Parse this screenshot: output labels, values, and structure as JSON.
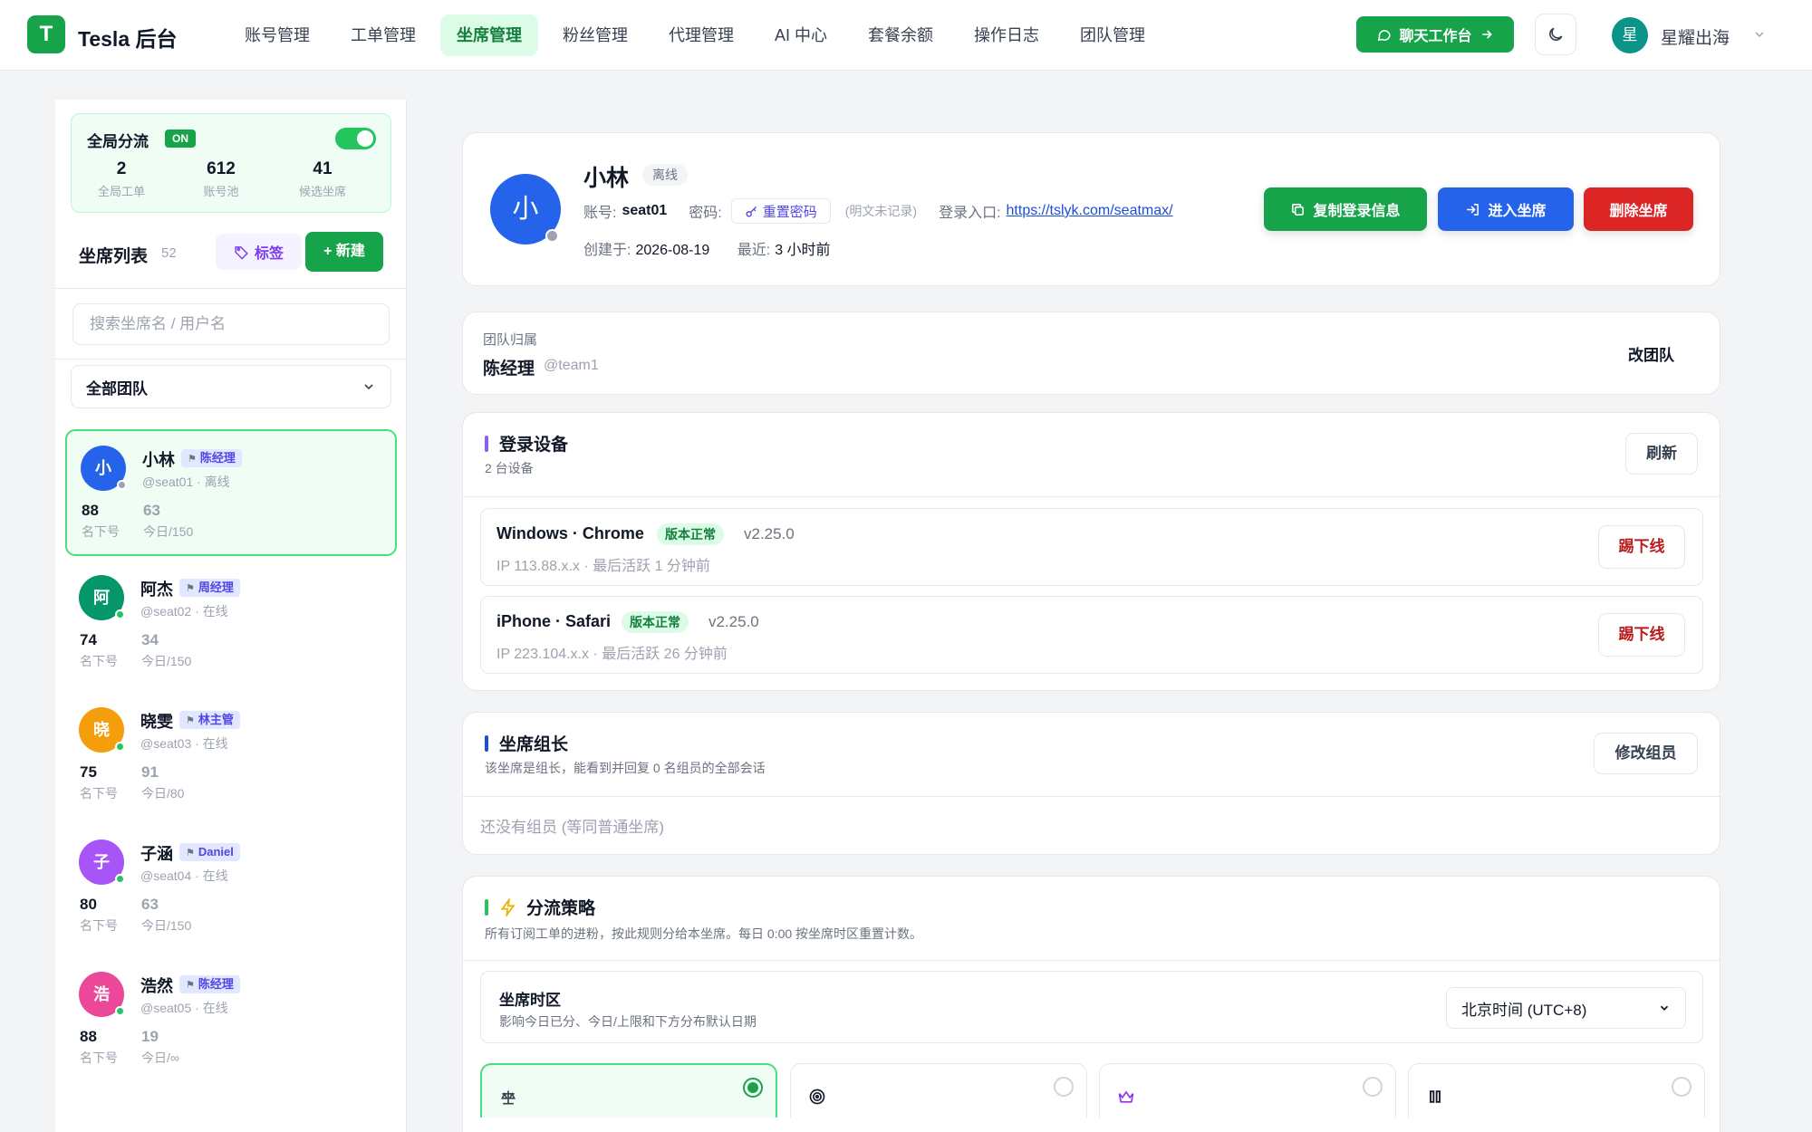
{
  "brand": {
    "name": "Tesla 后台",
    "logo_letter": "T"
  },
  "nav": [
    {
      "label": "账号管理"
    },
    {
      "label": "工单管理"
    },
    {
      "label": "坐席管理",
      "active": true
    },
    {
      "label": "粉丝管理"
    },
    {
      "label": "代理管理"
    },
    {
      "label": "AI 中心"
    },
    {
      "label": "套餐余额"
    },
    {
      "label": "操作日志"
    },
    {
      "label": "团队管理"
    }
  ],
  "header": {
    "chat_label": "聊天工作台",
    "user_initial": "星",
    "user_name": "星耀出海"
  },
  "global": {
    "title": "全局分流",
    "badge": "ON",
    "enabled": true,
    "stats": [
      {
        "value": "2",
        "label": "全局工单"
      },
      {
        "value": "612",
        "label": "账号池"
      },
      {
        "value": "41",
        "label": "候选坐席"
      }
    ]
  },
  "seat_list": {
    "title": "坐席列表",
    "count": "52",
    "tag_label": "标签",
    "new_label": "+ 新建",
    "search_placeholder": "搜索坐席名 / 用户名",
    "team_filter": "全部团队",
    "items": [
      {
        "initial": "小",
        "name": "小林",
        "tag": "陈经理",
        "sub": "@seat01 · 离线",
        "v1": "88",
        "l1": "名下号",
        "v2": "63",
        "l2": "今日/150",
        "avatar_color": "#2563eb",
        "status_color": "#9ca3af"
      },
      {
        "initial": "阿",
        "name": "阿杰",
        "tag": "周经理",
        "sub": "@seat02 · 在线",
        "v1": "74",
        "l1": "名下号",
        "v2": "34",
        "l2": "今日/150",
        "avatar_color": "#059669",
        "status_color": "#22c55e"
      },
      {
        "initial": "晓",
        "name": "晓雯",
        "tag": "林主管",
        "sub": "@seat03 · 在线",
        "v1": "75",
        "l1": "名下号",
        "v2": "91",
        "l2": "今日/80",
        "avatar_color": "#f59e0b",
        "status_color": "#22c55e"
      },
      {
        "initial": "子",
        "name": "子涵",
        "tag": "Daniel",
        "sub": "@seat04 · 在线",
        "v1": "80",
        "l1": "名下号",
        "v2": "63",
        "l2": "今日/150",
        "avatar_color": "#a855f7",
        "status_color": "#22c55e"
      },
      {
        "initial": "浩",
        "name": "浩然",
        "tag": "陈经理",
        "sub": "@seat05 · 在线",
        "v1": "88",
        "l1": "名下号",
        "v2": "19",
        "l2": "今日/∞",
        "avatar_color": "#ec4899",
        "status_color": "#22c55e"
      }
    ]
  },
  "profile": {
    "initial": "小",
    "name": "小林",
    "status": "离线",
    "account_label": "账号:",
    "account": "seat01",
    "password_label": "密码:",
    "reset_label": "重置密码",
    "plain_note": "(明文未记录)",
    "login_label": "登录入口:",
    "login_url": "https://tslyk.com/seatmax/",
    "created_label": "创建于:",
    "created": "2026-08-19",
    "recent_label": "最近:",
    "recent": "3 小时前",
    "copy_label": "复制登录信息",
    "enter_label": "进入坐席",
    "delete_label": "删除坐席"
  },
  "team": {
    "label": "团队归属",
    "name": "陈经理",
    "handle": "@team1",
    "change_label": "改团队"
  },
  "devices": {
    "title": "登录设备",
    "count": "2 台设备",
    "refresh_label": "刷新",
    "items": [
      {
        "name": "Windows · Chrome",
        "badge": "版本正常",
        "version": "v2.25.0",
        "sub": "IP 113.88.x.x · 最后活跃 1 分钟前",
        "kick_label": "踢下线"
      },
      {
        "name": "iPhone · Safari",
        "badge": "版本正常",
        "version": "v2.25.0",
        "sub": "IP 223.104.x.x · 最后活跃 26 分钟前",
        "kick_label": "踢下线"
      }
    ]
  },
  "leader": {
    "title": "坐席组长",
    "desc": "该坐席是组长，能看到并回复 0 名组员的全部会话",
    "edit_label": "修改组员",
    "empty": "还没有组员 (等同普通坐席)"
  },
  "strategy": {
    "title": "分流策略",
    "desc": "所有订阅工单的进粉，按此规则分给本坐席。每日 0:00 按坐席时区重置计数。",
    "tz_title": "坐席时区",
    "tz_desc": "影响今日已分、今日/上限和下方分布默认日期",
    "tz_value": "北京时间 (UTC+8)",
    "options": [
      {
        "icon": "balance-scale-icon",
        "selected": true
      },
      {
        "icon": "target-icon",
        "selected": false
      },
      {
        "icon": "crown-icon",
        "selected": false
      },
      {
        "icon": "pause-icon",
        "selected": false
      }
    ]
  },
  "colors": {
    "accent_green": "#16a34a",
    "blue": "#2563eb",
    "red": "#dc2626",
    "devices_bar": "#8b5cf6",
    "leader_bar": "#1d4ed8",
    "strategy_bar": "#22c55e"
  }
}
